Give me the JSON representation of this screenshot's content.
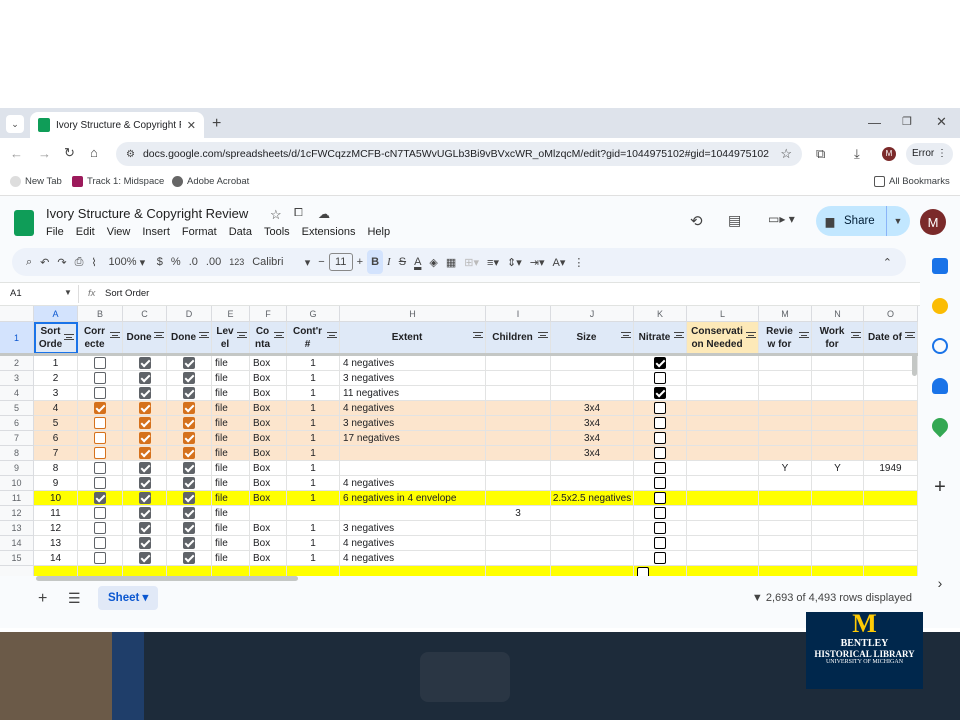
{
  "browser": {
    "tab_title": "Ivory Structure & Copyright Re",
    "url": "docs.google.com/spreadsheets/d/1cFWCqzzMCFB-cN7TA5WvUGLb3Bi9vBVxcWR_oMlzqcM/edit?gid=1044975102#gid=1044975102",
    "error_label": "Error",
    "profile_initial": "M",
    "bookmarks": [
      "New Tab",
      "Track 1: Midspace",
      "Adobe Acrobat"
    ],
    "all_bookmarks": "All Bookmarks"
  },
  "sheet": {
    "title": "Ivory Structure & Copyright Review",
    "menus": [
      "File",
      "Edit",
      "View",
      "Insert",
      "Format",
      "Data",
      "Tools",
      "Extensions",
      "Help"
    ],
    "share_label": "Share",
    "avatar_initial": "M",
    "zoom": "100%",
    "currency": "$",
    "percent": "%",
    "dec_less": ".0",
    "dec_more": ".00",
    "format_num": "123",
    "font": "Calibri",
    "font_size": "11",
    "name_box": "A1",
    "formula": "Sort Order",
    "sheet_tab": "Sheet",
    "rows_displayed": "2,693 of 4,493 rows displayed"
  },
  "grid": {
    "columns": [
      "A",
      "B",
      "C",
      "D",
      "E",
      "F",
      "G",
      "H",
      "I",
      "J",
      "K",
      "L",
      "M",
      "N",
      "O"
    ],
    "headers": [
      "Sort Orde",
      "Corr ecte",
      "Done",
      "Done",
      "Lev el",
      "Co nta",
      "Cont'r #",
      "Extent",
      "Children",
      "Size",
      "Nitrate",
      "Conservati on Needed",
      "Revie w for",
      "Work for",
      "Date of"
    ],
    "rows": [
      {
        "n": "2",
        "a": "1",
        "b": false,
        "c": true,
        "d": true,
        "e": "file",
        "f": "Box",
        "g": "1",
        "h": "4 negatives",
        "i": "",
        "j": "",
        "k": true,
        "m": "",
        "nn": "",
        "o": "",
        "style": ""
      },
      {
        "n": "3",
        "a": "2",
        "b": false,
        "c": true,
        "d": true,
        "e": "file",
        "f": "Box",
        "g": "1",
        "h": "3 negatives",
        "i": "",
        "j": "",
        "k": false,
        "m": "",
        "nn": "",
        "o": "",
        "style": ""
      },
      {
        "n": "4",
        "a": "3",
        "b": false,
        "c": true,
        "d": true,
        "e": "file",
        "f": "Box",
        "g": "1",
        "h": "11 negatives",
        "i": "",
        "j": "",
        "k": true,
        "m": "",
        "nn": "",
        "o": "",
        "style": ""
      },
      {
        "n": "5",
        "a": "4",
        "b": true,
        "c": true,
        "d": true,
        "e": "file",
        "f": "Box",
        "g": "1",
        "h": "4 negatives",
        "i": "",
        "j": "3x4",
        "k": false,
        "m": "",
        "nn": "",
        "o": "",
        "style": "orange"
      },
      {
        "n": "6",
        "a": "5",
        "b": false,
        "c": true,
        "d": true,
        "e": "file",
        "f": "Box",
        "g": "1",
        "h": "3 negatives",
        "i": "",
        "j": "3x4",
        "k": false,
        "m": "",
        "nn": "",
        "o": "",
        "style": "orange"
      },
      {
        "n": "7",
        "a": "6",
        "b": false,
        "c": true,
        "d": true,
        "e": "file",
        "f": "Box",
        "g": "1",
        "h": "17 negatives",
        "i": "",
        "j": "3x4",
        "k": false,
        "m": "",
        "nn": "",
        "o": "",
        "style": "orange"
      },
      {
        "n": "8",
        "a": "7",
        "b": false,
        "c": true,
        "d": true,
        "e": "file",
        "f": "Box",
        "g": "1",
        "h": "",
        "i": "",
        "j": "3x4",
        "k": false,
        "m": "",
        "nn": "",
        "o": "",
        "style": "orange"
      },
      {
        "n": "9",
        "a": "8",
        "b": false,
        "c": true,
        "d": true,
        "e": "file",
        "f": "Box",
        "g": "1",
        "h": "",
        "i": "",
        "j": "",
        "k": false,
        "m": "Y",
        "nn": "Y",
        "o": "1949",
        "style": ""
      },
      {
        "n": "10",
        "a": "9",
        "b": false,
        "c": true,
        "d": true,
        "e": "file",
        "f": "Box",
        "g": "1",
        "h": "4 negatives",
        "i": "",
        "j": "",
        "k": false,
        "m": "",
        "nn": "",
        "o": "",
        "style": ""
      },
      {
        "n": "11",
        "a": "10",
        "b": true,
        "c": true,
        "d": true,
        "e": "file",
        "f": "Box",
        "g": "1",
        "h": "6 negatives in 4 envelope",
        "i": "",
        "j": "2.5x2.5 negatives",
        "k": false,
        "m": "",
        "nn": "",
        "o": "",
        "style": "yellow"
      },
      {
        "n": "12",
        "a": "11",
        "b": false,
        "c": true,
        "d": true,
        "e": "file",
        "f": "",
        "g": "",
        "h": "",
        "i": "3",
        "j": "",
        "k": false,
        "m": "",
        "nn": "",
        "o": "",
        "style": ""
      },
      {
        "n": "13",
        "a": "12",
        "b": false,
        "c": true,
        "d": true,
        "e": "file",
        "f": "Box",
        "g": "1",
        "h": "3 negatives",
        "i": "",
        "j": "",
        "k": false,
        "m": "",
        "nn": "",
        "o": "",
        "style": ""
      },
      {
        "n": "14",
        "a": "13",
        "b": false,
        "c": true,
        "d": true,
        "e": "file",
        "f": "Box",
        "g": "1",
        "h": "4 negatives",
        "i": "",
        "j": "",
        "k": false,
        "m": "",
        "nn": "",
        "o": "",
        "style": ""
      },
      {
        "n": "15",
        "a": "14",
        "b": false,
        "c": true,
        "d": true,
        "e": "file",
        "f": "Box",
        "g": "1",
        "h": "4 negatives",
        "i": "",
        "j": "",
        "k": false,
        "m": "",
        "nn": "",
        "o": "",
        "style": ""
      }
    ],
    "row1_label": "1"
  },
  "logo": {
    "line1": "BENTLEY",
    "line2": "HISTORICAL LIBRARY",
    "line3": "UNIVERSITY OF MICHIGAN",
    "mark": "M"
  },
  "colors": {
    "orange_row": "#fce5cd",
    "yellow_row": "#ffff00",
    "header_blue": "#dfe9f7",
    "header_tan": "#fde9b8"
  }
}
